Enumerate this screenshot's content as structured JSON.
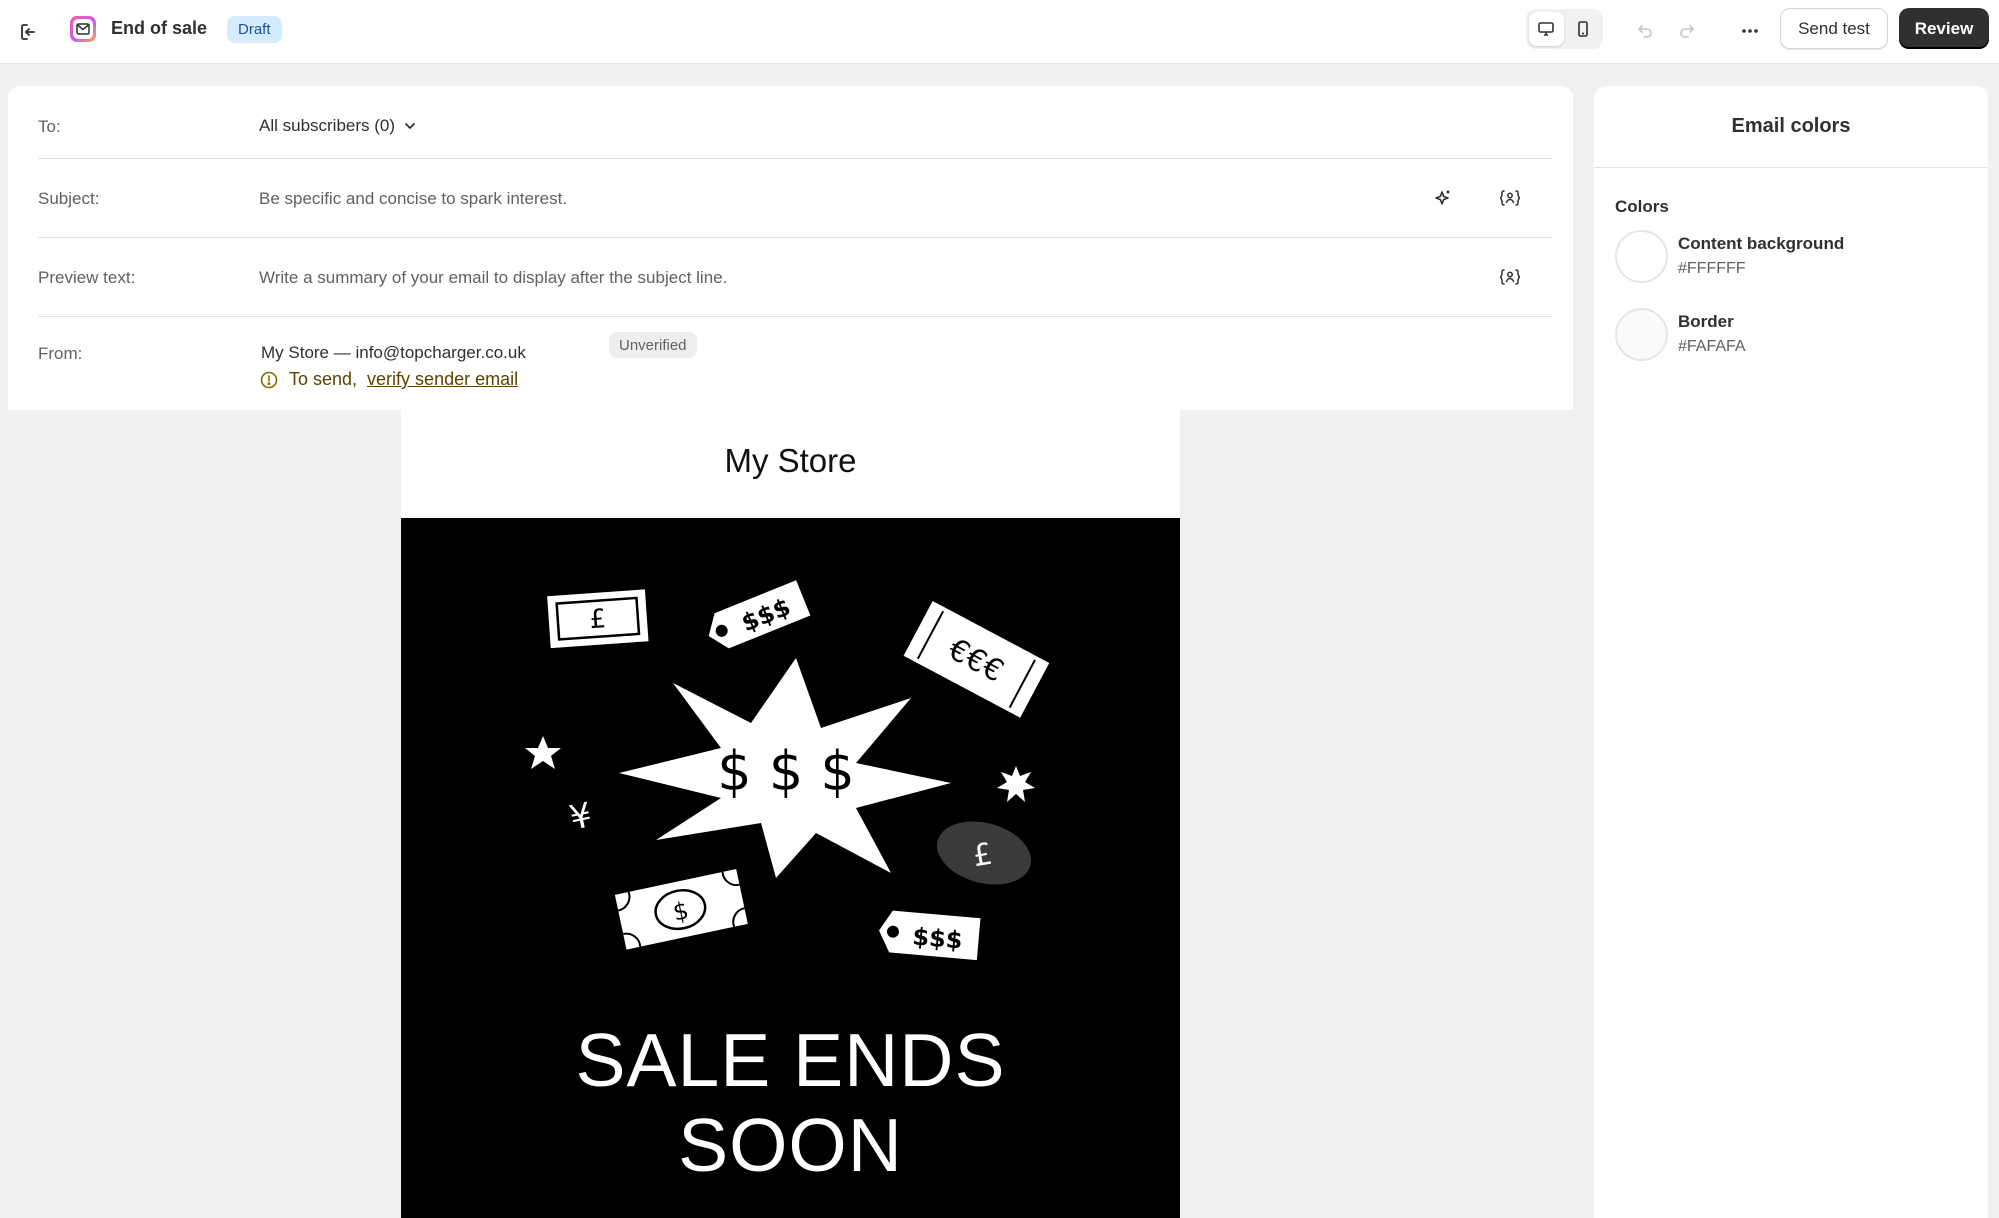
{
  "topbar": {
    "title": "End of sale",
    "status_badge": "Draft",
    "send_test_label": "Send test",
    "review_label": "Review"
  },
  "fields": {
    "to_label": "To:",
    "to_value": "All subscribers (0)",
    "subject_label": "Subject:",
    "subject_placeholder": "Be specific and concise to spark interest.",
    "preview_label": "Preview text:",
    "preview_placeholder": "Write a summary of your email to display after the subject line.",
    "from_label": "From:",
    "from_value": "My Store — info@topcharger.co.uk",
    "from_badge": "Unverified",
    "warning_prefix": "To send,",
    "warning_link": "verify sender email"
  },
  "email_preview": {
    "store_name": "My Store",
    "headline_line1": "SALE ENDS",
    "headline_line2": "SOON",
    "illustration_text": {
      "pound_note": "£",
      "tag_top": "$$$",
      "euro_tag": "€€€",
      "burst": "$ $ $",
      "yen": "¥",
      "dollar_note": "$",
      "pound_coin": "£",
      "tag_bottom": "$$$"
    }
  },
  "sidebar": {
    "title": "Email colors",
    "section_label": "Colors",
    "colors": [
      {
        "name": "Content background",
        "hex": "#FFFFFF"
      },
      {
        "name": "Border",
        "hex": "#FAFAFA"
      }
    ]
  }
}
